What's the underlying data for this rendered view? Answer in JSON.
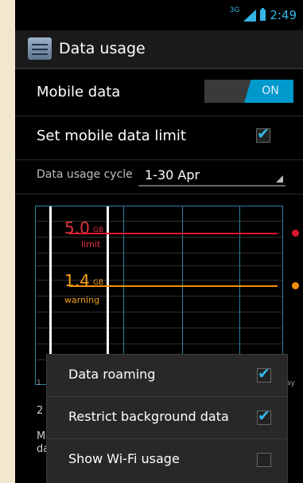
{
  "status_bar": {
    "network": "3G",
    "time": "2:49"
  },
  "action_bar": {
    "title": "Data usage",
    "icon": "data-usage-app-icon"
  },
  "settings": {
    "mobile_data": {
      "label": "Mobile data",
      "toggle_text": "ON"
    },
    "data_limit": {
      "label": "Set mobile data limit",
      "checked": true
    },
    "cycle": {
      "label": "Data usage cycle",
      "value": "1-30 Apr"
    }
  },
  "chart": {
    "limit": {
      "value": "5.0",
      "unit": "GB",
      "label": "limit"
    },
    "warning": {
      "value": "1.4",
      "unit": "GB",
      "label": "warning"
    },
    "axis_left": "1",
    "axis_right": "ay"
  },
  "under_menu": {
    "line1": "2",
    "line2": "M",
    "line3": "da"
  },
  "menu": {
    "items": [
      {
        "label": "Data roaming",
        "checked": true
      },
      {
        "label": "Restrict background data",
        "checked": true
      },
      {
        "label": "Show Wi-Fi usage",
        "checked": false
      }
    ]
  },
  "colors": {
    "accent": "#33b5e5",
    "limit": "#d9182c",
    "warning": "#f48f0b"
  }
}
